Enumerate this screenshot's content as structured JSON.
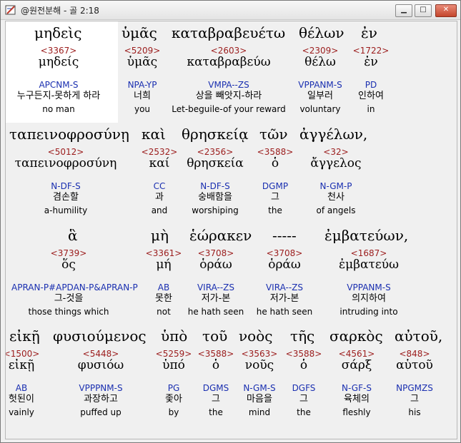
{
  "window": {
    "title": "@원전분해 - 골 2:18",
    "minimize": "▁",
    "maximize": "□",
    "close": "✕"
  },
  "rows": [
    {
      "greek": [
        "μηδεὶς",
        "ὑμᾶς",
        "καταβραβευέτω",
        "θέλων",
        "ἐν"
      ],
      "words": [
        {
          "num": "<3367>",
          "lemma": "μηδείς",
          "parse": "APCNM-S",
          "kor": "누구든지-못하게 하라",
          "eng": "no man"
        },
        {
          "num": "<5209>",
          "lemma": "ὑμᾶς",
          "parse": "NPA-YP",
          "kor": "너희",
          "eng": "you"
        },
        {
          "num": "<2603>",
          "lemma": "καταβραβεύω",
          "parse": "VMPA--ZS",
          "kor": "상을 빼앗지-하라",
          "eng": "Let-beguile-of your reward"
        },
        {
          "num": "<2309>",
          "lemma": "θέλω",
          "parse": "VPPANM-S",
          "kor": "일부러",
          "eng": "voluntary"
        },
        {
          "num": "<1722>",
          "lemma": "ἐν",
          "parse": "PD",
          "kor": "인하여",
          "eng": "in"
        }
      ]
    },
    {
      "greek": [
        "ταπεινοφροσύνῃ",
        "καὶ",
        "θρησκείᾳ",
        "τῶν",
        "ἀγγέλων,"
      ],
      "words": [
        {
          "num": "<5012>",
          "lemma": "ταπεινοφροσύνη",
          "parse": "N-DF-S",
          "kor": "겸손할",
          "eng": "a-humility"
        },
        {
          "num": "<2532>",
          "lemma": "καί",
          "parse": "CC",
          "kor": "과",
          "eng": "and"
        },
        {
          "num": "<2356>",
          "lemma": "θρησκεία",
          "parse": "N-DF-S",
          "kor": "숭배함을",
          "eng": "worshiping"
        },
        {
          "num": "<3588>",
          "lemma": "ὁ",
          "parse": "DGMP",
          "kor": "그",
          "eng": "the"
        },
        {
          "num": "<32>",
          "lemma": "ἄγγελος",
          "parse": "N-GM-P",
          "kor": "천사",
          "eng": "of angels"
        }
      ]
    },
    {
      "greek": [
        "ἃ",
        "μὴ",
        "ἑώρακεν",
        "-----",
        "ἐμβατεύων,"
      ],
      "words": [
        {
          "num": "<3739>",
          "lemma": "ὅς",
          "parse": "APRAN-P#APDAN-P&APRAN-P",
          "kor": "그-것을",
          "eng": "those things which"
        },
        {
          "num": "<3361>",
          "lemma": "μή",
          "parse": "AB",
          "kor": "못한",
          "eng": "not"
        },
        {
          "num": "<3708>",
          "lemma": "ὁράω",
          "parse": "VIRA--ZS",
          "kor": "저가-본",
          "eng": "he hath seen"
        },
        {
          "num": "<3708>",
          "lemma": "ὁράω",
          "parse": "VIRA--ZS",
          "kor": "저가-본",
          "eng": "he hath seen"
        },
        {
          "num": "<1687>",
          "lemma": "ἐμβατεύω",
          "parse": "VPPANM-S",
          "kor": "의지하여",
          "eng": "intruding into"
        }
      ]
    },
    {
      "greek": [
        "εἰκῇ",
        "φυσιούμενος",
        "ὑπὸ",
        "τοῦ",
        "νοὸς",
        "τῆς",
        "σαρκὸς",
        "αὐτοῦ,"
      ],
      "words": [
        {
          "num": "<1500>",
          "lemma": "εἰκῇ",
          "parse": "AB",
          "kor": "헛된이",
          "eng": "vainly"
        },
        {
          "num": "<5448>",
          "lemma": "φυσιόω",
          "parse": "VPPPNM-S",
          "kor": "과장하고",
          "eng": "puffed up"
        },
        {
          "num": "<5259>",
          "lemma": "ὑπό",
          "parse": "PG",
          "kor": "좇아",
          "eng": "by"
        },
        {
          "num": "<3588>",
          "lemma": "ὁ",
          "parse": "DGMS",
          "kor": "그",
          "eng": "the"
        },
        {
          "num": "<3563>",
          "lemma": "νοῦς",
          "parse": "N-GM-S",
          "kor": "마음을",
          "eng": "mind"
        },
        {
          "num": "<3588>",
          "lemma": "ὁ",
          "parse": "DGFS",
          "kor": "그",
          "eng": "the"
        },
        {
          "num": "<4561>",
          "lemma": "σάρξ",
          "parse": "N-GF-S",
          "kor": "육체의",
          "eng": "fleshly"
        },
        {
          "num": "<848>",
          "lemma": "αὑτοῦ",
          "parse": "NPGMZS",
          "kor": "그",
          "eng": "his"
        }
      ]
    }
  ]
}
